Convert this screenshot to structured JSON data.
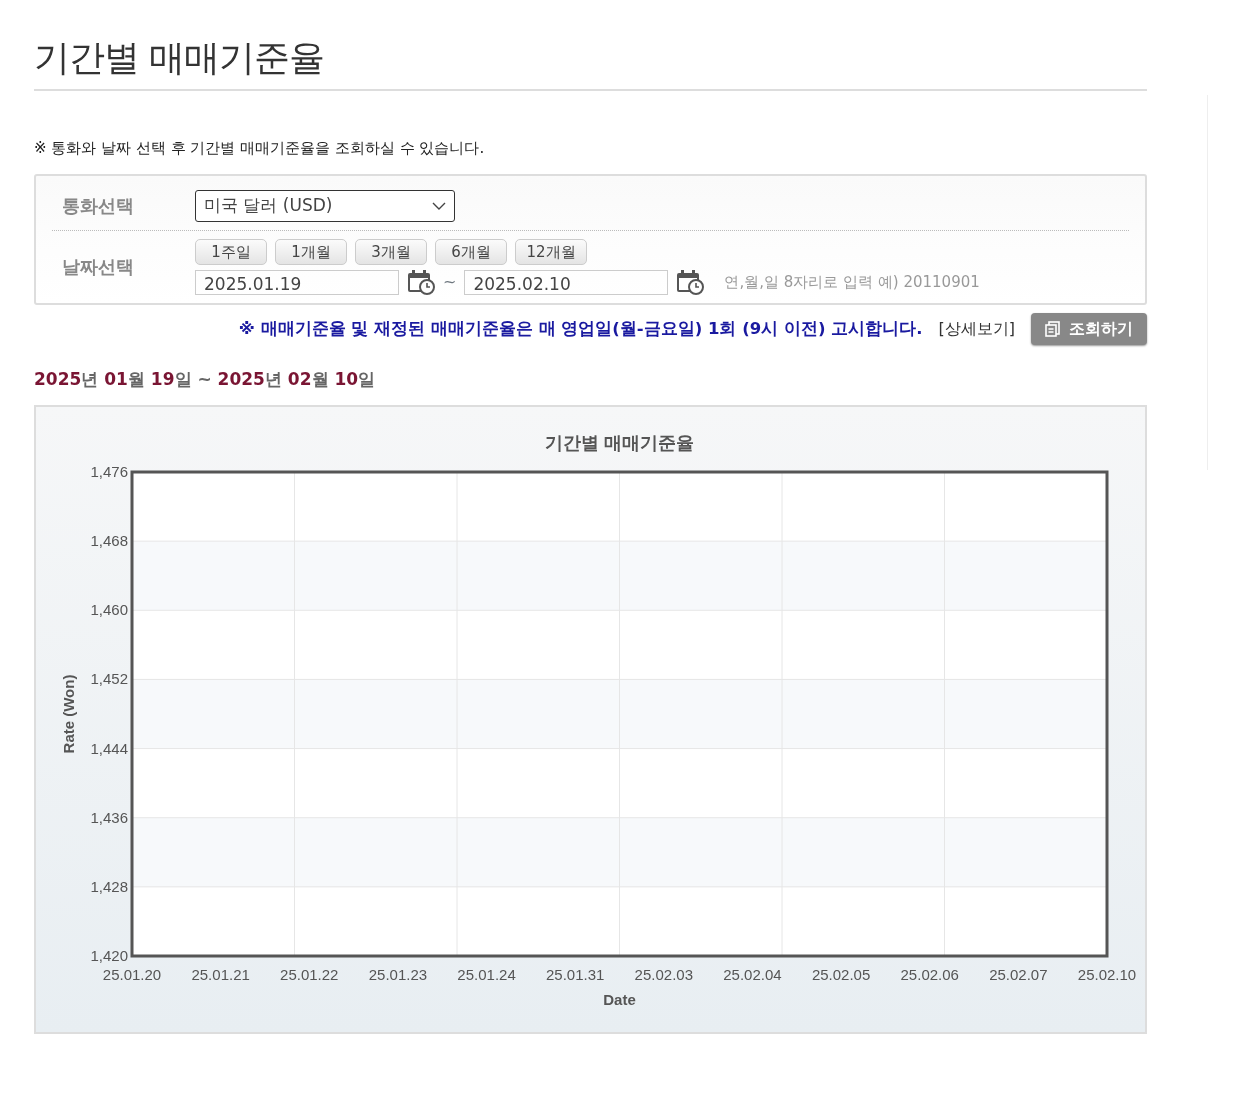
{
  "page_title": "기간별 매매기준율",
  "notice": "※ 통화와 날짜 선택 후 기간별 매매기준율을 조회하실 수 있습니다.",
  "form": {
    "currency_label": "통화선택",
    "currency_value": "미국 달러 (USD)",
    "date_label": "날짜선택",
    "periods": [
      "1주일",
      "1개월",
      "3개월",
      "6개월",
      "12개월"
    ],
    "start_date": "2025.01.19",
    "separator": "~",
    "end_date": "2025.02.10",
    "hint": "연,월,일 8자리로 입력 예) 20110901"
  },
  "announcement": "※ 매매기준율 및 재정된 매매기준율은 매 영업일(월-금요일) 1회 (9시 이전) 고시합니다.",
  "detail_link": "[상세보기]",
  "search_button": "조회하기",
  "range": [
    {
      "kind": "number",
      "text": "2025"
    },
    {
      "kind": "unit",
      "text": "년"
    },
    {
      "kind": "number",
      "text": "01"
    },
    {
      "kind": "unit",
      "text": "월"
    },
    {
      "kind": "number",
      "text": "19"
    },
    {
      "kind": "unit",
      "text": "일"
    },
    {
      "kind": "unit",
      "text": "~"
    },
    {
      "kind": "number",
      "text": "2025"
    },
    {
      "kind": "unit",
      "text": "년"
    },
    {
      "kind": "number",
      "text": "02"
    },
    {
      "kind": "unit",
      "text": "월"
    },
    {
      "kind": "number",
      "text": "10"
    },
    {
      "kind": "unit",
      "text": "일"
    }
  ],
  "chart": {
    "chart_data": {
      "type": "line",
      "grid": true,
      "title": "기간별 매매기준율",
      "xlabel": "Date",
      "ylabel": "Rate (Won)",
      "categories": [
        "25.01.20",
        "25.01.21",
        "25.01.22",
        "25.01.23",
        "25.01.24",
        "25.01.31",
        "25.02.03",
        "25.02.04",
        "25.02.05",
        "25.02.06",
        "25.02.07",
        "25.02.10"
      ],
      "ylim": [
        1420,
        1476
      ],
      "yticks": [
        {
          "value": 1420,
          "label": "1,420"
        },
        {
          "value": 1428,
          "label": "1,428"
        },
        {
          "value": 1436,
          "label": "1,436"
        },
        {
          "value": 1444,
          "label": "1,444"
        },
        {
          "value": 1452,
          "label": "1,452"
        },
        {
          "value": 1460,
          "label": "1,460"
        },
        {
          "value": 1468,
          "label": "1,468"
        },
        {
          "value": 1476,
          "label": "1,476"
        }
      ]
    }
  }
}
